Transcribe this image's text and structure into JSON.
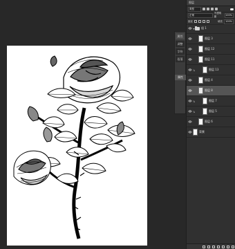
{
  "app": {
    "panel_title": "图层",
    "tool_tabs": [
      "属性",
      "调整",
      "字符",
      "段落"
    ],
    "mini_tab": "属性"
  },
  "layers_panel": {
    "filter_label": "类型",
    "blend_mode": "正常",
    "opacity_label": "不透明度",
    "opacity_value": "100%",
    "lock_label": "锁定",
    "fill_label": "填充",
    "fill_value": "100%",
    "items": [
      {
        "label": "组 1",
        "kind": "group",
        "selected": false
      },
      {
        "label": "图层 3",
        "kind": "layer",
        "selected": false
      },
      {
        "label": "图层 12",
        "kind": "layer",
        "selected": false
      },
      {
        "label": "图层 11",
        "kind": "layer",
        "selected": false
      },
      {
        "label": "图层 13",
        "kind": "layer",
        "selected": false
      },
      {
        "label": "图层 4",
        "kind": "layer",
        "selected": false
      },
      {
        "label": "图层 8",
        "kind": "layer",
        "selected": true
      },
      {
        "label": "图层 7",
        "kind": "layer",
        "selected": false
      },
      {
        "label": "图层 5",
        "kind": "layer",
        "selected": false
      },
      {
        "label": "图层 6",
        "kind": "layer",
        "selected": false
      },
      {
        "label": "背景",
        "kind": "background",
        "selected": false
      }
    ]
  },
  "canvas": {
    "background_color": "#ffffff",
    "illustration": "rose-line-art"
  },
  "colors": {
    "workspace": "#282828",
    "panel": "#303030",
    "selected_layer": "#555555"
  }
}
